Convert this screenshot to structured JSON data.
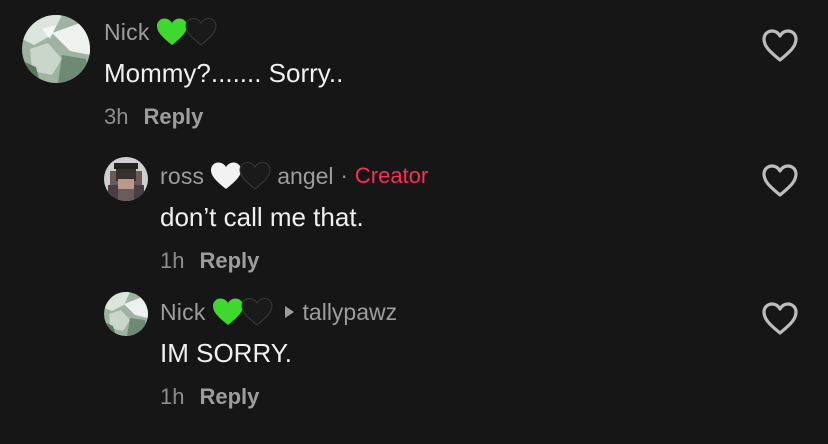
{
  "comments": [
    {
      "username": "Nick",
      "hearts": [
        "green-heart",
        "black-heart"
      ],
      "text": "Mommy?....... Sorry..",
      "time": "3h",
      "reply": "Reply"
    },
    {
      "username": "ross",
      "hearts": [
        "white-heart",
        "black-heart"
      ],
      "secondary_name": "angel",
      "separator": "·",
      "badge": "Creator",
      "text": "don’t call me that.",
      "time": "1h",
      "reply": "Reply"
    },
    {
      "username": "Nick",
      "hearts": [
        "green-heart",
        "black-heart"
      ],
      "reply_to": "tallypawz",
      "text": "IM SORRY.",
      "time": "1h",
      "reply": "Reply"
    }
  ],
  "colors": {
    "background": "#161616",
    "username": "#9d9d9d",
    "text": "#f0f0f0",
    "creator_badge": "#fe2c55",
    "green_heart": "#3fd82e",
    "white_heart": "#f2f2f2",
    "black_heart": "#1a1a1a"
  }
}
